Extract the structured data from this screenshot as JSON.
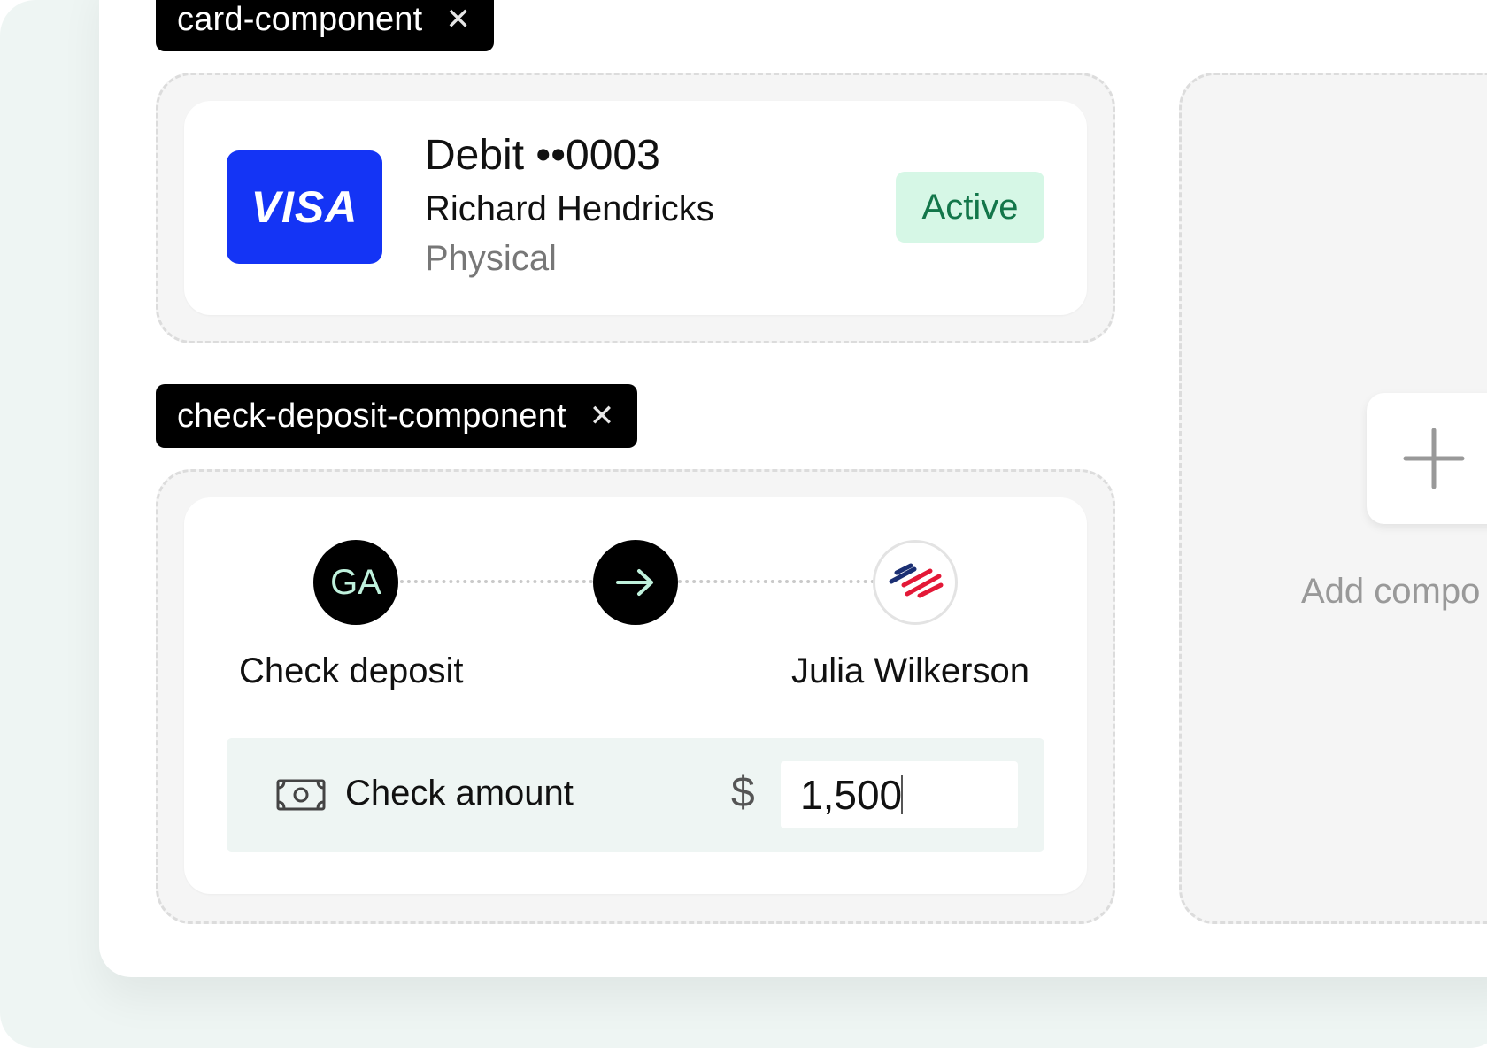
{
  "components": {
    "card": {
      "tag_label": "card-component",
      "brand": "VISA",
      "title": "Debit ••0003",
      "holder": "Richard Hendricks",
      "type": "Physical",
      "status": "Active",
      "colors": {
        "brand": "#1434f5",
        "status_bg": "#d6f7e6",
        "status_text": "#13764a"
      }
    },
    "check_deposit": {
      "tag_label": "check-deposit-component",
      "source_initials": "GA",
      "source_label": "Check deposit",
      "recipient_label": "Julia Wilkerson",
      "amount_label": "Check amount",
      "currency_symbol": "$",
      "amount_value": "1,500"
    }
  },
  "add_panel": {
    "label": "Add compo"
  },
  "icons": {
    "close": "x-icon",
    "arrow": "arrow-right-icon",
    "bank": "bank-logo",
    "money": "money-icon",
    "add": "plus-icon"
  }
}
